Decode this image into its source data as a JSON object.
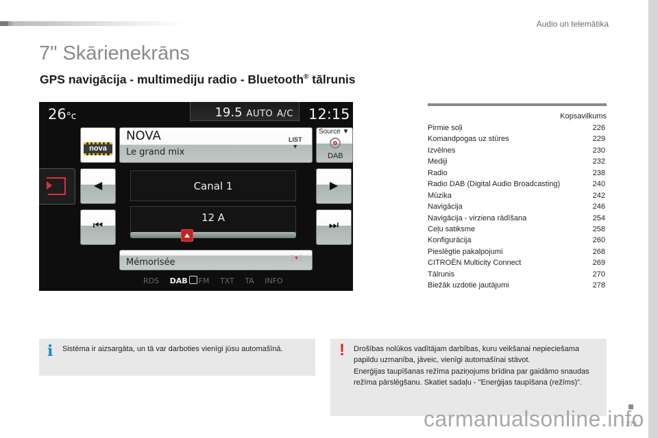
{
  "header": {
    "section_label": "Audio un telemātika"
  },
  "page": {
    "title": "7\" Skārienekrāns",
    "subtitle_main": "GPS navigācija - multimediju radio - Bluetooth",
    "subtitle_reg": "®",
    "subtitle_end": " tālrunis",
    "page_number": "275",
    "watermark": "carmanualsonline.info"
  },
  "screen": {
    "temperature": "26",
    "temperature_unit": "°c",
    "climate_setpoint": "19.5",
    "climate_mode": "AUTO",
    "climate_ac": "A/C",
    "clock": "12:15",
    "station_logo": "nova",
    "station_name": "NOVA",
    "station_program": "Le grand mix",
    "list_label": "LIST",
    "list_arrow": "▼",
    "source_label": "Source ▼",
    "source_value": "DAB",
    "prev_glyph": "◀",
    "next_glyph": "▶",
    "skip_back_glyph": "⏮",
    "skip_forward_glyph": "⏭",
    "multiplex_label": "Canal 1",
    "channel_label": "12 A",
    "slider_position": 0.33,
    "preset_label": "Mémorisée",
    "preset_icon": "⋮▾⋮",
    "tabs": {
      "rds": "RDS",
      "dab": "DAB",
      "fm": "FM",
      "txt": "TXT",
      "ta": "TA",
      "info": "INFO"
    },
    "icons": {
      "exit": "exit-icon",
      "source": "antenna-icon",
      "preset": "preset-list-icon"
    },
    "accent_color": "#c32025"
  },
  "toc": {
    "heading": "Kopsavilkums",
    "items": [
      {
        "label": "Pirmie soļi",
        "page": "226"
      },
      {
        "label": "Komandpogas uz stūres",
        "page": "229"
      },
      {
        "label": "Izvēlnes",
        "page": "230"
      },
      {
        "label": "Mediji",
        "page": "232"
      },
      {
        "label": "Radio",
        "page": "238"
      },
      {
        "label": "Radio DAB (Digital Audio Broadcasting)",
        "page": "240"
      },
      {
        "label": "Mūzika",
        "page": "242"
      },
      {
        "label": "Navigācija",
        "page": "246"
      },
      {
        "label": "Navigācija - virziena rādīšana",
        "page": "254"
      },
      {
        "label": "Ceļu satiksme",
        "page": "258"
      },
      {
        "label": "Konfigurācija",
        "page": "260"
      },
      {
        "label": "Pieslēgtie pakalpojumi",
        "page": "268"
      },
      {
        "label": "CITROËN Multicity Connect",
        "page": "269"
      },
      {
        "label": "Tālrunis",
        "page": "270"
      },
      {
        "label": "Biežāk uzdotie jautājumi",
        "page": "278"
      }
    ]
  },
  "notes": {
    "info": {
      "icon": "i",
      "text": "Sistēma ir aizsargāta, un tā var darboties vienīgi jūsu automašīnā."
    },
    "warning": {
      "icon": "!",
      "text_1": "Drošības nolūkos vadītājam darbības, kuru veikšanai nepieciešama papildu uzmanība, jāveic, vienīgi automašīnai stāvot.",
      "text_2": "Enerģijas taupīšanas režīma paziņojums brīdina par gaidāmo snaudas režīma pārslēgšanu. Skatiet sadaļu - \"Enerģijas taupīšana (režīms)\"."
    }
  }
}
